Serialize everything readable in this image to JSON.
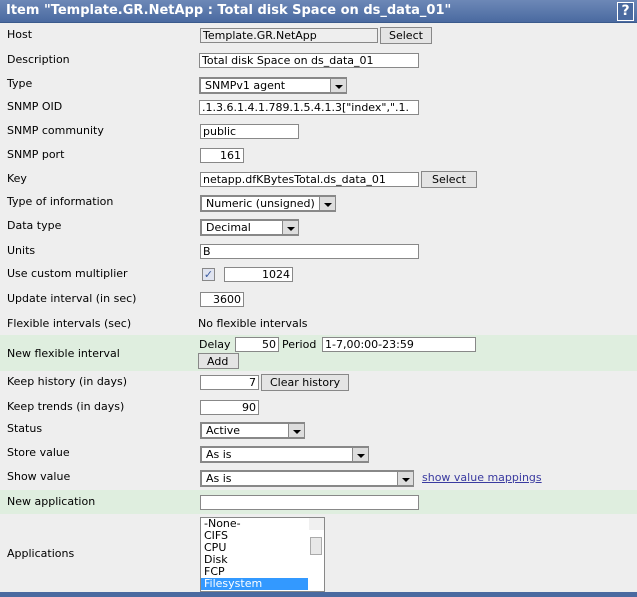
{
  "title": "Item \"Template.GR.NetApp : Total disk Space on ds_data_01\"",
  "help_label": "?",
  "fields": {
    "host": {
      "label": "Host",
      "value": "Template.GR.NetApp",
      "button": "Select"
    },
    "description": {
      "label": "Description",
      "value": "Total disk Space on ds_data_01"
    },
    "type": {
      "label": "Type",
      "value": "SNMPv1 agent"
    },
    "snmp_oid": {
      "label": "SNMP OID",
      "value": ".1.3.6.1.4.1.789.1.5.4.1.3[\"index\",\".1."
    },
    "snmp_community": {
      "label": "SNMP community",
      "value": "public"
    },
    "snmp_port": {
      "label": "SNMP port",
      "value": "161"
    },
    "key": {
      "label": "Key",
      "value": "netapp.dfKBytesTotal.ds_data_01",
      "button": "Select"
    },
    "type_of_information": {
      "label": "Type of information",
      "value": "Numeric (unsigned)"
    },
    "data_type": {
      "label": "Data type",
      "value": "Decimal"
    },
    "units": {
      "label": "Units",
      "value": "B"
    },
    "custom_multiplier": {
      "label": "Use custom multiplier",
      "checked": true,
      "value": "1024"
    },
    "update_interval": {
      "label": "Update interval (in sec)",
      "value": "3600"
    },
    "flexible_intervals": {
      "label": "Flexible intervals (sec)",
      "value": "No flexible intervals"
    },
    "new_flexible_interval": {
      "label": "New flexible interval",
      "delay_label": "Delay",
      "delay": "50",
      "period_label": "Period",
      "period": "1-7,00:00-23:59",
      "button": "Add"
    },
    "keep_history": {
      "label": "Keep history (in days)",
      "value": "7",
      "button": "Clear history"
    },
    "keep_trends": {
      "label": "Keep trends (in days)",
      "value": "90"
    },
    "status": {
      "label": "Status",
      "value": "Active"
    },
    "store_value": {
      "label": "Store value",
      "value": "As is"
    },
    "show_value": {
      "label": "Show value",
      "value": "As is",
      "link": "show value mappings"
    },
    "new_application": {
      "label": "New application",
      "value": ""
    },
    "applications": {
      "label": "Applications",
      "options": [
        "-None-",
        "CIFS",
        "CPU",
        "Disk",
        "FCP",
        "Filesystem"
      ],
      "selected": "Filesystem"
    }
  }
}
